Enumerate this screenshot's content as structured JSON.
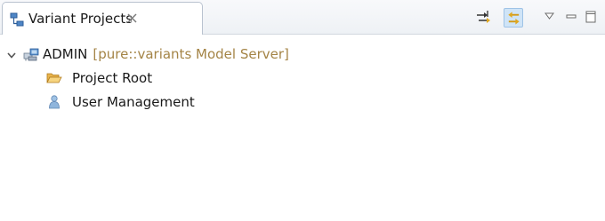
{
  "view": {
    "title": "Variant Projects",
    "icons": {
      "tab": "hierarchy-icon",
      "close": "close-icon",
      "toolbar_sync": "synchronize-icon",
      "toolbar_link": "link-with-editor-icon",
      "view_menu": "chevron-down-icon",
      "minimize": "minimize-icon",
      "maximize": "maximize-icon"
    }
  },
  "tree": {
    "root": {
      "label": "ADMIN",
      "decoration": "[pure::variants Model Server]",
      "expanded": true,
      "icon": "server-icon"
    },
    "children": [
      {
        "label": "Project Root",
        "icon": "folder-open-icon"
      },
      {
        "label": "User Management",
        "icon": "user-icon"
      }
    ]
  },
  "colors": {
    "decoration": "#a48446",
    "selected_button": "#cfe4f7",
    "tab_border": "#b9c2cf"
  }
}
